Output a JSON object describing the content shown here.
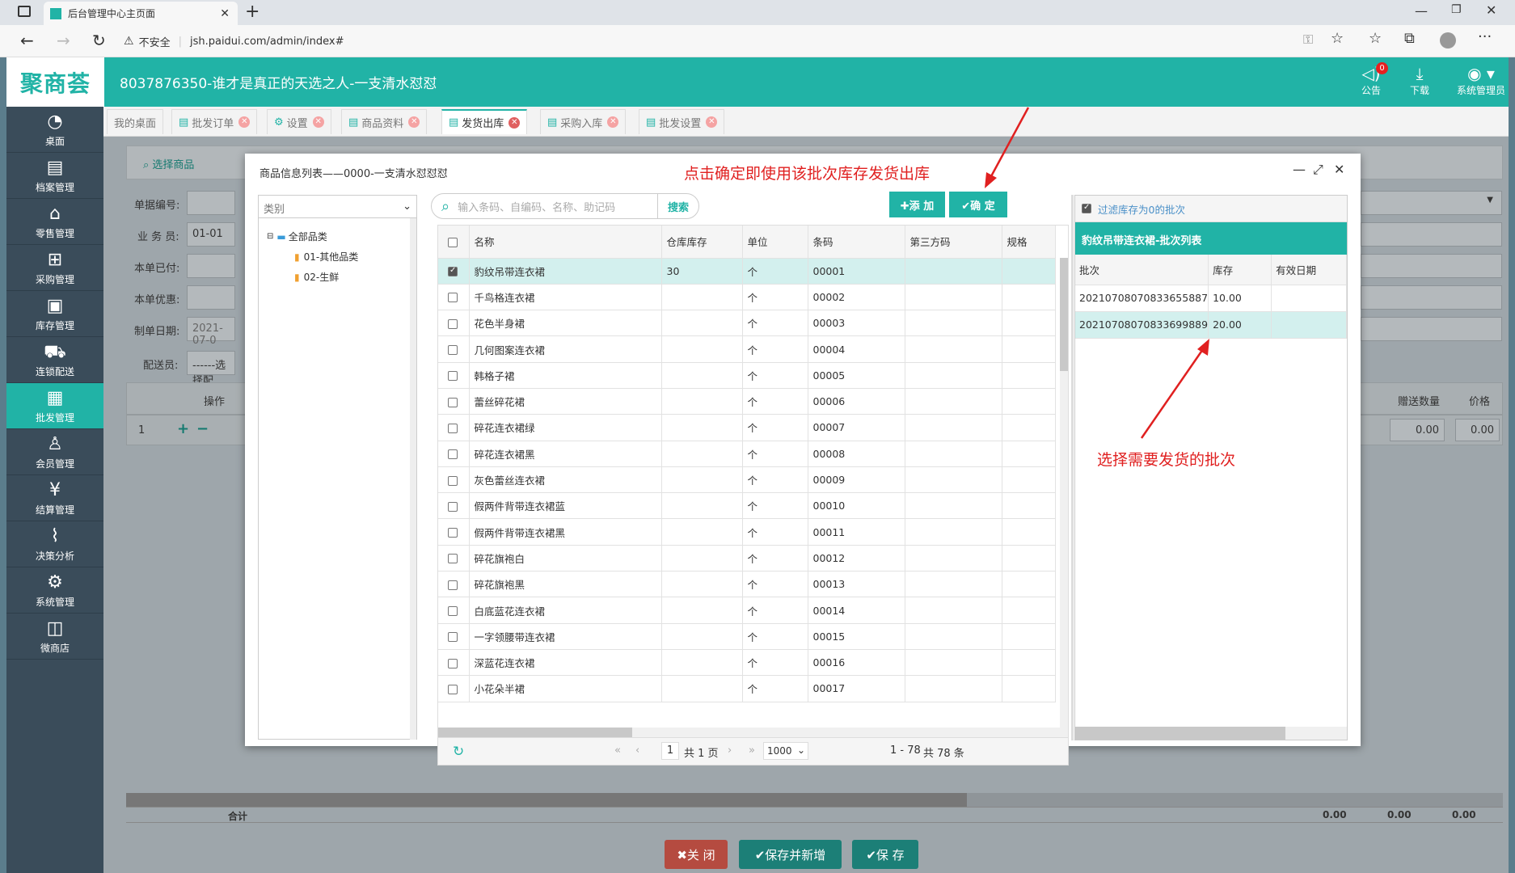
{
  "browser": {
    "tab_title": "后台管理中心主页面",
    "security": "不安全",
    "url": "jsh.paidui.com/admin/index#"
  },
  "header": {
    "logo": "聚商荟",
    "title": "8037876350-谁才是真正的天选之人-一支清水怼怼",
    "notice_label": "公告",
    "notice_count": "0",
    "download_label": "下载",
    "user_label": "系统管理员"
  },
  "sidebar": {
    "items": [
      {
        "label": "桌面",
        "icon": "dashboard-icon"
      },
      {
        "label": "档案管理",
        "icon": "file-icon"
      },
      {
        "label": "零售管理",
        "icon": "store-icon"
      },
      {
        "label": "采购管理",
        "icon": "purchase-icon"
      },
      {
        "label": "库存管理",
        "icon": "inventory-icon"
      },
      {
        "label": "连锁配送",
        "icon": "truck-icon"
      },
      {
        "label": "批发管理",
        "icon": "wholesale-icon"
      },
      {
        "label": "会员管理",
        "icon": "member-icon"
      },
      {
        "label": "结算管理",
        "icon": "money-icon"
      },
      {
        "label": "决策分析",
        "icon": "chart-icon"
      },
      {
        "label": "系统管理",
        "icon": "gear-icon"
      },
      {
        "label": "微商店",
        "icon": "shop-icon"
      }
    ]
  },
  "tabs": {
    "t0": "我的桌面",
    "t1": "批发订单",
    "t2": "设置",
    "t3": "商品资料",
    "t4": "发货出库",
    "t5": "采购入库",
    "t6": "批发设置"
  },
  "form": {
    "select_goods": "选择商品",
    "doc_no_label": "单据编号:",
    "salesman_label": "业 务 员:",
    "salesman_value": "01-01",
    "paid_label": "本单已付:",
    "discount_label": "本单优惠:",
    "date_label": "制单日期:",
    "date_value": "2021-07-0",
    "delivery_label": "配送员:",
    "delivery_value": "------选择配",
    "col_op": "操作",
    "row_no": "1",
    "col_gift": "赠送数量",
    "col_price": "价格",
    "gift_value": "0.00",
    "price_value": "0.00",
    "total_label": "合计",
    "total1": "0.00",
    "total2": "0.00",
    "total3": "0.00",
    "close_btn": "✖关 闭",
    "save_new_btn": "✔保存并新增",
    "save_btn": "✔保 存"
  },
  "dialog": {
    "title": "商品信息列表——0000-一支清水怼怼怼",
    "annotation_top": "点击确定即使用该批次库存发货出库",
    "annotation_right": "选择需要发货的批次",
    "category_placeholder": "类别",
    "tree_root": "全部品类",
    "tree_child1": "01-其他品类",
    "tree_child2": "02-生鲜",
    "search_placeholder": "输入条码、自编码、名称、助记码",
    "search_btn": "搜索",
    "add_btn": "✚添 加",
    "confirm_btn": "✔确 定",
    "columns": {
      "name": "名称",
      "stock": "仓库库存",
      "unit": "单位",
      "barcode": "条码",
      "third": "第三方码",
      "spec": "规格"
    },
    "rows": [
      {
        "name": "豹纹吊带连衣裙",
        "stock": "30",
        "unit": "个",
        "barcode": "00001"
      },
      {
        "name": "千鸟格连衣裙",
        "stock": "",
        "unit": "个",
        "barcode": "00002"
      },
      {
        "name": "花色半身裙",
        "stock": "",
        "unit": "个",
        "barcode": "00003"
      },
      {
        "name": "几何图案连衣裙",
        "stock": "",
        "unit": "个",
        "barcode": "00004"
      },
      {
        "name": "韩格子裙",
        "stock": "",
        "unit": "个",
        "barcode": "00005"
      },
      {
        "name": "蕾丝碎花裙",
        "stock": "",
        "unit": "个",
        "barcode": "00006"
      },
      {
        "name": "碎花连衣裙绿",
        "stock": "",
        "unit": "个",
        "barcode": "00007"
      },
      {
        "name": "碎花连衣裙黑",
        "stock": "",
        "unit": "个",
        "barcode": "00008"
      },
      {
        "name": "灰色蕾丝连衣裙",
        "stock": "",
        "unit": "个",
        "barcode": "00009"
      },
      {
        "name": "假两件背带连衣裙蓝",
        "stock": "",
        "unit": "个",
        "barcode": "00010"
      },
      {
        "name": "假两件背带连衣裙黑",
        "stock": "",
        "unit": "个",
        "barcode": "00011"
      },
      {
        "name": "碎花旗袍白",
        "stock": "",
        "unit": "个",
        "barcode": "00012"
      },
      {
        "name": "碎花旗袍黑",
        "stock": "",
        "unit": "个",
        "barcode": "00013"
      },
      {
        "name": "白底蓝花连衣裙",
        "stock": "",
        "unit": "个",
        "barcode": "00014"
      },
      {
        "name": "一字领腰带连衣裙",
        "stock": "",
        "unit": "个",
        "barcode": "00015"
      },
      {
        "name": "深蓝花连衣裙",
        "stock": "",
        "unit": "个",
        "barcode": "00016"
      },
      {
        "name": "小花朵半裙",
        "stock": "",
        "unit": "个",
        "barcode": "00017"
      }
    ],
    "pager": {
      "page": "1",
      "total_pages": "共 1 页",
      "page_size": "1000",
      "range": "1 - 78",
      "total": "共 78 条"
    },
    "filter_label": "过滤库存为0的批次",
    "batch_title": "豹纹吊带连衣裙-批次列表",
    "batch_columns": {
      "batch": "批次",
      "stock": "库存",
      "expiry": "有效日期"
    },
    "batches": [
      {
        "batch": "20210708070833655887",
        "stock": "10.00",
        "expiry": ""
      },
      {
        "batch": "20210708070833699889",
        "stock": "20.00",
        "expiry": ""
      }
    ]
  },
  "colors": {
    "accent": "#21b3a6",
    "annotation": "#e02020",
    "sidebar": "#3a4c5a"
  }
}
